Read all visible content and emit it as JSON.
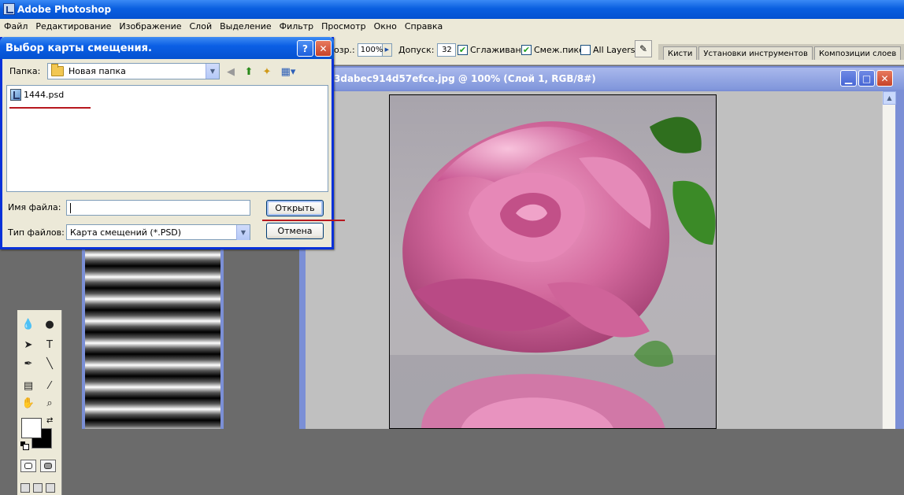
{
  "app": {
    "title": "Adobe Photoshop"
  },
  "menu": [
    "Файл",
    "Редактирование",
    "Изображение",
    "Слой",
    "Выделение",
    "Фильтр",
    "Просмотр",
    "Окно",
    "Справка"
  ],
  "options_bar": {
    "opacity_label": "озр.:",
    "opacity_value": "100%",
    "tolerance_label": "Допуск:",
    "tolerance_value": "32",
    "antialias_label": "Сглаживание",
    "antialias_checked": true,
    "contiguous_label": "Смеж.пикс.",
    "contiguous_checked": true,
    "all_layers_label": "All Layers",
    "all_layers_checked": false
  },
  "palette_well": {
    "tabs": [
      "Кисти",
      "Установки инструментов",
      "Композиции слоев"
    ]
  },
  "document": {
    "title": "3dabec914d57efce.jpg @ 100% (Слой 1, RGB/8#)"
  },
  "dialog": {
    "title": "Выбор карты смещения.",
    "folder_label": "Папка:",
    "folder_value": "Новая папка",
    "files": [
      "1444.psd"
    ],
    "filename_label": "Имя файла:",
    "filename_value": "",
    "filetype_label": "Тип файлов:",
    "filetype_value": "Карта смещений (*.PSD)",
    "open_label": "Открыть",
    "cancel_label": "Отмена"
  },
  "colors": {
    "xp_blue": "#0a5fe0",
    "annotation_red": "#b7171e",
    "doc_inactive_blue": "#7b8fd6",
    "rose_pink": "#d2689c",
    "leaf_green": "#2f6f1e"
  }
}
